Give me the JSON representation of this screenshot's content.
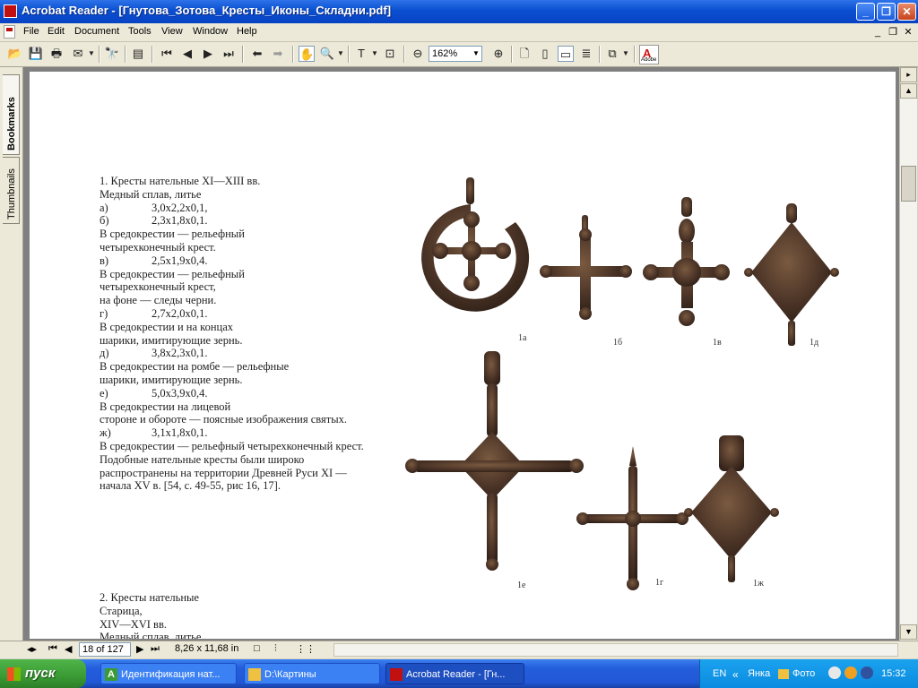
{
  "window": {
    "title": "Acrobat Reader - [Гнутова_Зотова_Кресты_Иконы_Складни.pdf]",
    "buttons": {
      "minimize": "_",
      "restore": "❐",
      "close": "✕"
    }
  },
  "menubar": {
    "items": [
      "File",
      "Edit",
      "Document",
      "Tools",
      "View",
      "Window",
      "Help"
    ]
  },
  "toolbar": {
    "zoom": "162%"
  },
  "navtabs": [
    "Bookmarks",
    "Thumbnails"
  ],
  "document": {
    "heading": "1. Кресты нательные XI—XIII вв.",
    "material": "Медный сплав, литье",
    "rows": [
      {
        "k": "а)",
        "v": "3,0x2,2x0,1,"
      },
      {
        "k": "б)",
        "v": "2,3x1,8x0,1."
      },
      {
        "text": "В средокрестии — рельефный"
      },
      {
        "text": "четырехконечный крест."
      },
      {
        "k": "в)",
        "v": "2,5x1,9x0,4."
      },
      {
        "text": "В средокрестии — рельефный"
      },
      {
        "text": "четырехконечный крест,"
      },
      {
        "text": "на фоне — следы черни."
      },
      {
        "k": "г)",
        "v": "2,7x2,0x0,1."
      },
      {
        "text": "В средокрестии и на концах"
      },
      {
        "text": "шарики, имитирующие зернь."
      },
      {
        "k": "д)",
        "v": "3,8x2,3x0,1."
      },
      {
        "text": "В средокрестии на ромбе — рельефные"
      },
      {
        "text": "шарики, имитирующие зернь."
      },
      {
        "k": "е)",
        "v": "5,0x3,9x0,4."
      },
      {
        "text": "В средокрестии на лицевой"
      },
      {
        "text": "стороне и обороте — поясные изображения святых."
      },
      {
        "k": "ж)",
        "v": "3,1x1,8x0,1."
      },
      {
        "text": "В средокрестии — рельефный четырехконечный крест."
      },
      {
        "text": "Подобные нательные кресты были широко"
      },
      {
        "text": "распространены на территории Древней Руси XI —"
      },
      {
        "text": "начала XV в. [54, с. 49-55, рис 16, 17]."
      }
    ],
    "section2": [
      "2. Кресты нательные",
      "Старица,",
      "XIV—XVI вв.",
      "Медный сплав, литье"
    ],
    "captions": {
      "a": "1а",
      "b": "1б",
      "v": "1в",
      "g": "1д",
      "e": "1е",
      "g2": "1г",
      "zh": "1ж"
    }
  },
  "statusbar": {
    "page": "18 of 127",
    "size": "8,26 x 11,68 in"
  },
  "taskbar": {
    "start": "пуск",
    "tasks": [
      "Идентификация нат...",
      "D:\\Картины",
      "Acrobat Reader - [Гн..."
    ],
    "tray": {
      "lang": "EN",
      "user": "Янка",
      "folder": "Фото",
      "time": "15:32"
    }
  }
}
